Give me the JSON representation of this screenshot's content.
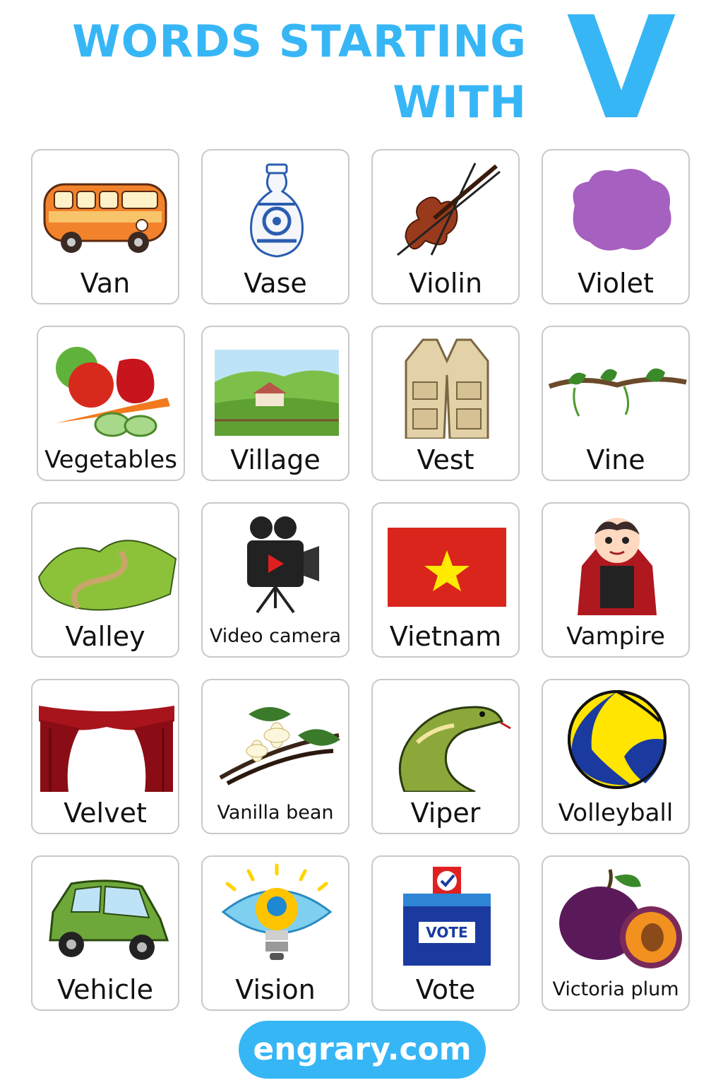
{
  "title": {
    "line1": "WORDS STARTING",
    "line2": "WITH",
    "letter": "V"
  },
  "words": [
    "Van",
    "Vase",
    "Violin",
    "Violet",
    "Vegetables",
    "Village",
    "Vest",
    "Vine",
    "Valley",
    "Video camera",
    "Vietnam",
    "Vampire",
    "Velvet",
    "Vanilla bean",
    "Viper",
    "Volleyball",
    "Vehicle",
    "Vision",
    "Vote",
    "Victoria plum"
  ],
  "vote_box_text": "VOTE",
  "footer": "engrary.com",
  "colors": {
    "accent": "#37b6f6",
    "card_border": "#c9c9c9"
  }
}
